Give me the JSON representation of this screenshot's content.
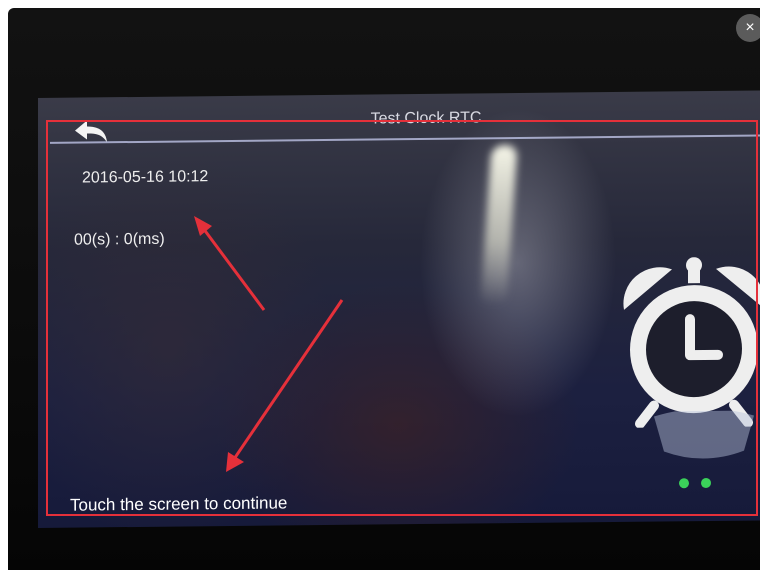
{
  "screen": {
    "title": "Test Clock RTC",
    "datetime": "2016-05-16 10:12",
    "counter": "00(s) : 0(ms)",
    "prompt": "Touch the screen to continue"
  },
  "overlay": {
    "close_symbol": "×",
    "annotation_color": "#e5303a"
  },
  "icons": {
    "back": "back-arrow-icon",
    "alarm": "alarm-clock-icon",
    "close": "close-icon"
  }
}
